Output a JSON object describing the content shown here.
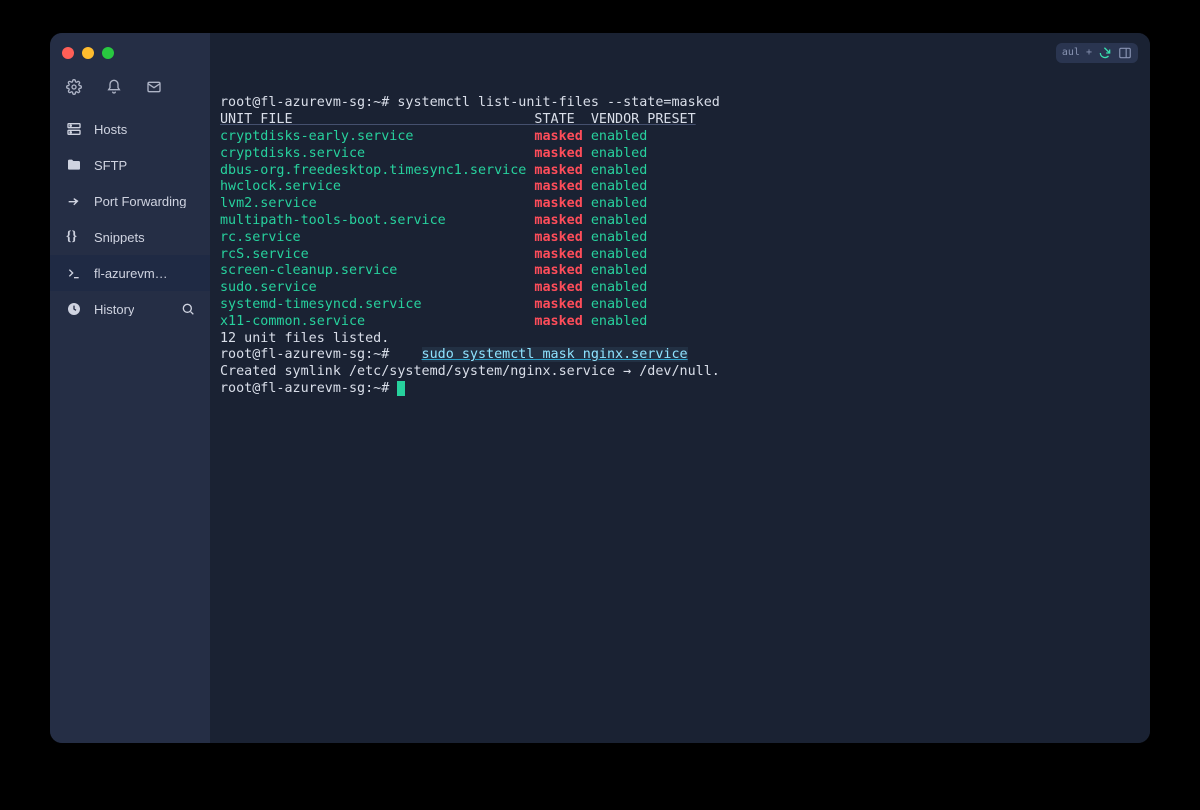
{
  "sidebar": {
    "items": {
      "hosts": "Hosts",
      "sftp": "SFTP",
      "portfwd": "Port Forwarding",
      "snippets": "Snippets",
      "session": "fl-azurevm…",
      "history": "History"
    }
  },
  "topright": {
    "label": "aul +"
  },
  "term": {
    "prompt": "root@fl-azurevm-sg:~#",
    "cmd1": "systemctl list-unit-files --state=masked",
    "header": {
      "unit": "UNIT FILE",
      "state": "STATE",
      "preset": "VENDOR PRESET"
    },
    "rows": [
      {
        "unit": "cryptdisks-early.service",
        "state": "masked",
        "preset": "enabled"
      },
      {
        "unit": "cryptdisks.service",
        "state": "masked",
        "preset": "enabled"
      },
      {
        "unit": "dbus-org.freedesktop.timesync1.service",
        "state": "masked",
        "preset": "enabled"
      },
      {
        "unit": "hwclock.service",
        "state": "masked",
        "preset": "enabled"
      },
      {
        "unit": "lvm2.service",
        "state": "masked",
        "preset": "enabled"
      },
      {
        "unit": "multipath-tools-boot.service",
        "state": "masked",
        "preset": "enabled"
      },
      {
        "unit": "rc.service",
        "state": "masked",
        "preset": "enabled"
      },
      {
        "unit": "rcS.service",
        "state": "masked",
        "preset": "enabled"
      },
      {
        "unit": "screen-cleanup.service",
        "state": "masked",
        "preset": "enabled"
      },
      {
        "unit": "sudo.service",
        "state": "masked",
        "preset": "enabled"
      },
      {
        "unit": "systemd-timesyncd.service",
        "state": "masked",
        "preset": "enabled"
      },
      {
        "unit": "x11-common.service",
        "state": "masked",
        "preset": "enabled"
      }
    ],
    "summary": "12 unit files listed.",
    "cmd2": "sudo systemctl mask nginx.service",
    "result": "Created symlink /etc/systemd/system/nginx.service → /dev/null."
  }
}
